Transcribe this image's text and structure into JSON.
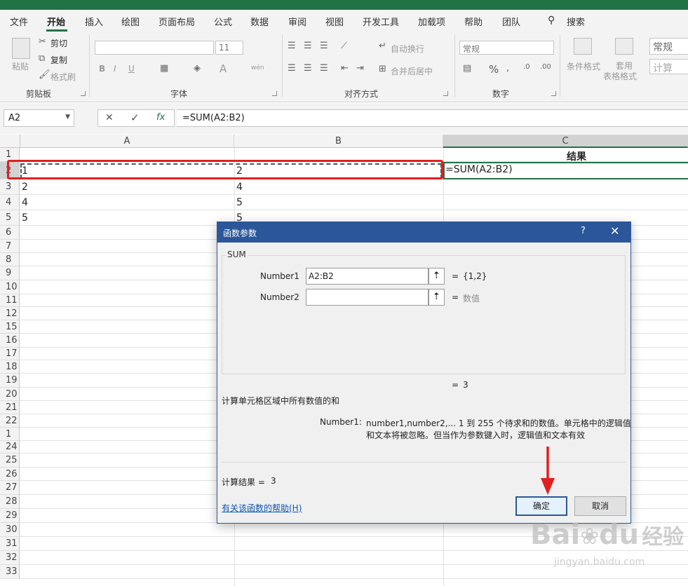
{
  "ribbon_tabs": [
    "文件",
    "开始",
    "插入",
    "绘图",
    "页面布局",
    "公式",
    "数据",
    "审阅",
    "视图",
    "开发工具",
    "加载项",
    "帮助",
    "团队"
  ],
  "search_label": "搜索",
  "clipboard": {
    "paste": "粘贴",
    "cut": "剪切",
    "copy": "复制",
    "format_painter": "格式刷",
    "group": "剪贴板"
  },
  "font": {
    "size": "11",
    "group": "字体",
    "bold": "B",
    "italic": "I",
    "underline": "U",
    "wen": "wén",
    "letter_a": "A"
  },
  "alignment": {
    "wrap": "自动换行",
    "merge": "合并后居中",
    "group": "对齐方式"
  },
  "number": {
    "format": "常规",
    "percent": "%",
    "group": "数字"
  },
  "styles": {
    "conditional": "条件格式",
    "table_1": "套用",
    "table_2": "表格格式",
    "style_normal": "常规",
    "style_calc": "计算"
  },
  "formula_bar": {
    "name_box": "A2",
    "formula": "=SUM(A2:B2)",
    "cancel": "✕",
    "enter": "✓",
    "fx": "fx"
  },
  "columns": [
    "A",
    "B",
    "C"
  ],
  "rows": [
    "1",
    "2",
    "3",
    "4",
    "5",
    "6",
    "7",
    "8",
    "9",
    "10",
    "11",
    "12",
    "15",
    "16",
    "17",
    "18",
    "19",
    "20",
    "21",
    "22",
    "1",
    "24",
    "25",
    "26",
    "27",
    "28",
    "29",
    "30",
    "31",
    "32",
    "33"
  ],
  "cells": {
    "c1": "结果",
    "a2": "1",
    "b2": "2",
    "c2": "=SUM(A2:B2)",
    "a3": "2",
    "b3": "4",
    "a4": "4",
    "b4": "5",
    "a5": "5",
    "b5": "5"
  },
  "dialog": {
    "title": "函数参数",
    "help_glyph": "?",
    "close_glyph": "✕",
    "function_name": "SUM",
    "arg1_label": "Number1",
    "arg1_value": "A2:B2",
    "arg1_result": "{1,2}",
    "arg2_label": "Number2",
    "arg2_value": "",
    "arg2_result": "数值",
    "equals": "=",
    "formula_value": "3",
    "description": "计算单元格区域中所有数值的和",
    "arg_desc_label": "Number1:",
    "arg_desc_line1": "number1,number2,...  1 到 255 个待求和的数值。单元格中的逻辑值",
    "arg_desc_line2": "和文本将被忽略。但当作为参数键入时，逻辑值和文本有效",
    "result_label": "计算结果 =",
    "result_value": "3",
    "help_link": "有关该函数的帮助(H)",
    "ok": "确定",
    "cancel": "取消"
  },
  "watermark": {
    "brand": "Bai",
    "brand2": "du",
    "jingyan": "经验",
    "url": "jingyan.baidu.com"
  },
  "colors": {
    "excel_green": "#217346",
    "dialog_blue": "#2b579a",
    "highlight_red": "#e02020"
  }
}
